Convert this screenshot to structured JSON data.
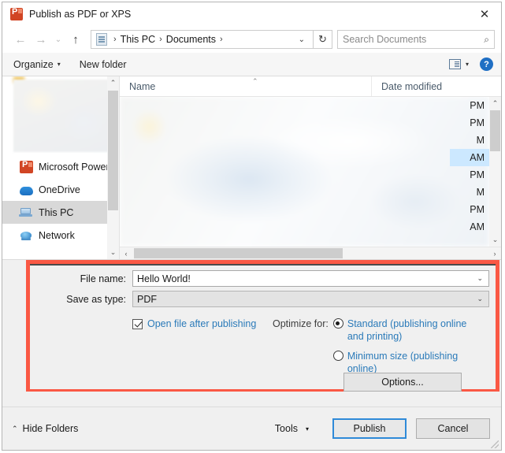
{
  "window": {
    "title": "Publish as PDF or XPS",
    "app_icon": "powerpoint-icon",
    "close_label": "✕"
  },
  "addressbar": {
    "back_icon": "←",
    "forward_icon": "→",
    "recent_icon": "⌄",
    "up_icon": "↑",
    "crumbs": [
      "This PC",
      "Documents"
    ],
    "separator": "›",
    "dropdown_icon": "⌄",
    "refresh_icon": "↻",
    "search_placeholder": "Search Documents",
    "search_icon": "⌕"
  },
  "toolbar": {
    "organize_label": "Organize",
    "organize_caret": "▾",
    "new_folder_label": "New folder",
    "view_caret": "▾",
    "help_label": "?"
  },
  "sidebar": {
    "items": [
      {
        "label": "Microsoft PowerPo",
        "icon": "powerpoint-icon",
        "selected": false
      },
      {
        "label": "OneDrive",
        "icon": "onedrive-cloud-icon",
        "selected": false
      },
      {
        "label": "This PC",
        "icon": "this-pc-icon",
        "selected": true
      },
      {
        "label": "Network",
        "icon": "network-globe-icon",
        "selected": false
      }
    ],
    "scroll_up": "⌃",
    "scroll_down": "⌄"
  },
  "filelist": {
    "columns": [
      "Name",
      "Date modified"
    ],
    "sort_indicator": "⌃",
    "visible_time_fragments": [
      {
        "text": "PM",
        "selected": false
      },
      {
        "text": "PM",
        "selected": false
      },
      {
        "text": "M",
        "selected": false
      },
      {
        "text": "AM",
        "selected": true
      },
      {
        "text": "PM",
        "selected": false
      },
      {
        "text": "M",
        "selected": false
      },
      {
        "text": "PM",
        "selected": false
      },
      {
        "text": "AM",
        "selected": false
      }
    ],
    "scroll_up": "⌃",
    "scroll_down": "⌄",
    "scroll_left": "‹",
    "scroll_right": "›"
  },
  "form": {
    "file_name_label": "File name:",
    "file_name_value": "Hello World!",
    "save_as_type_label": "Save as type:",
    "save_as_type_value": "PDF",
    "combo_caret": "⌄",
    "open_after_publishing_label": "Open file after publishing",
    "open_after_publishing_checked": true,
    "optimize_caption": "Optimize for:",
    "optimize_options": [
      {
        "label": "Standard (publishing online and printing)",
        "selected": true
      },
      {
        "label": "Minimum size (publishing online)",
        "selected": false
      }
    ],
    "options_button_label": "Options..."
  },
  "footer": {
    "hide_folders_label": "Hide Folders",
    "hide_folders_caret": "⌃",
    "tools_label": "Tools",
    "tools_caret": "▾",
    "publish_label": "Publish",
    "cancel_label": "Cancel"
  },
  "colors": {
    "highlight_red": "#fa5844",
    "link_blue": "#2a7ab9",
    "accent_blue": "#2f8ad8",
    "selection_blue": "#cce8ff"
  }
}
